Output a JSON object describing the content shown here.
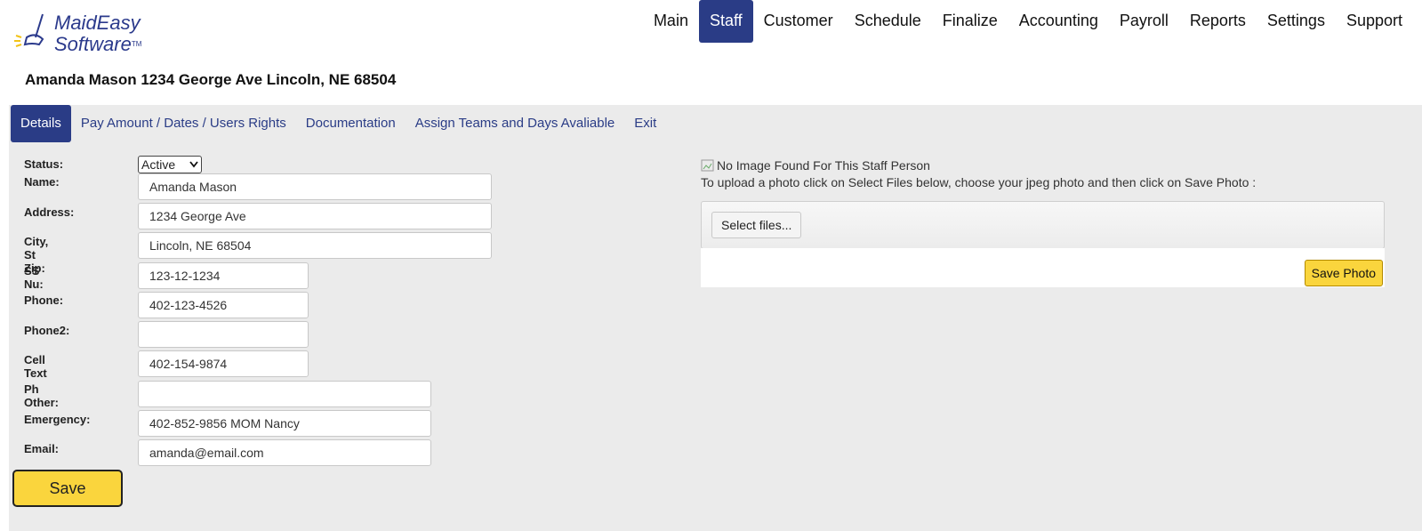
{
  "logo": {
    "line1": "MaidEasy",
    "line2": "Software",
    "tm": "TM"
  },
  "topnav": [
    {
      "label": "Main",
      "active": false
    },
    {
      "label": "Staff",
      "active": true
    },
    {
      "label": "Customer",
      "active": false
    },
    {
      "label": "Schedule",
      "active": false
    },
    {
      "label": "Finalize",
      "active": false
    },
    {
      "label": "Accounting",
      "active": false
    },
    {
      "label": "Payroll",
      "active": false
    },
    {
      "label": "Reports",
      "active": false
    },
    {
      "label": "Settings",
      "active": false
    },
    {
      "label": "Support",
      "active": false
    }
  ],
  "heading": "Amanda Mason 1234 George Ave Lincoln, NE 68504",
  "tabs": [
    {
      "label": "Details",
      "active": true
    },
    {
      "label": "Pay Amount / Dates / Users Rights",
      "active": false
    },
    {
      "label": "Documentation",
      "active": false
    },
    {
      "label": "Assign Teams and Days Avaliable",
      "active": false
    },
    {
      "label": "Exit",
      "active": false
    }
  ],
  "form": {
    "status": {
      "label": "Status:",
      "value": "Active"
    },
    "name": {
      "label": "Name:",
      "value": "Amanda Mason"
    },
    "address": {
      "label": "Address:",
      "value": "1234 George Ave"
    },
    "city": {
      "label": "City, St Zip:",
      "value": "Lincoln, NE 68504"
    },
    "ssn": {
      "label": "SS Nu:",
      "value": "123-12-1234"
    },
    "phone": {
      "label": "Phone:",
      "value": "402-123-4526"
    },
    "phone2": {
      "label": "Phone2:",
      "value": ""
    },
    "cell": {
      "label": "Cell Text",
      "value": "402-154-9874"
    },
    "ph_other": {
      "label": "Ph Other:",
      "value": ""
    },
    "emergency": {
      "label": "Emergency:",
      "value": "402-852-9856 MOM Nancy"
    },
    "email": {
      "label": "Email:",
      "value": "amanda@email.com"
    },
    "save_label": "Save"
  },
  "photo": {
    "no_image": "No Image Found For This Staff Person",
    "upload_instructions": "To upload a photo click on Select Files below, choose your jpeg photo and then click on Save Photo :",
    "select_files_label": "Select files...",
    "save_photo_label": "Save Photo"
  },
  "colors": {
    "nav_active": "#2a3c86",
    "button_yellow": "#fad53d",
    "panel_bg": "#ebebeb"
  }
}
